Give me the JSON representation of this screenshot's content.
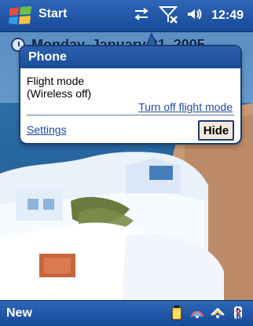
{
  "topbar": {
    "start_label": "Start",
    "time": "12:49",
    "icons": [
      "start-icon",
      "sync-icon",
      "signal-off-icon",
      "volume-icon"
    ]
  },
  "today": {
    "date": "Monday, January 31, 2005"
  },
  "popup": {
    "title": "Phone",
    "message_line1": "Flight mode",
    "message_line2": "(Wireless off)",
    "turn_off_link": "Turn off flight mode",
    "settings_link": "Settings",
    "hide_button": "Hide"
  },
  "bottombar": {
    "new_label": "New",
    "tray_icons": [
      "battery-icon",
      "connectivity-icon",
      "wifi-icon",
      "bluetooth-icon"
    ]
  },
  "colors": {
    "bar_blue": "#1b4d98",
    "popup_border": "#1b3d73",
    "link_blue": "#1d49a6",
    "hide_bg": "#f2e7db"
  }
}
